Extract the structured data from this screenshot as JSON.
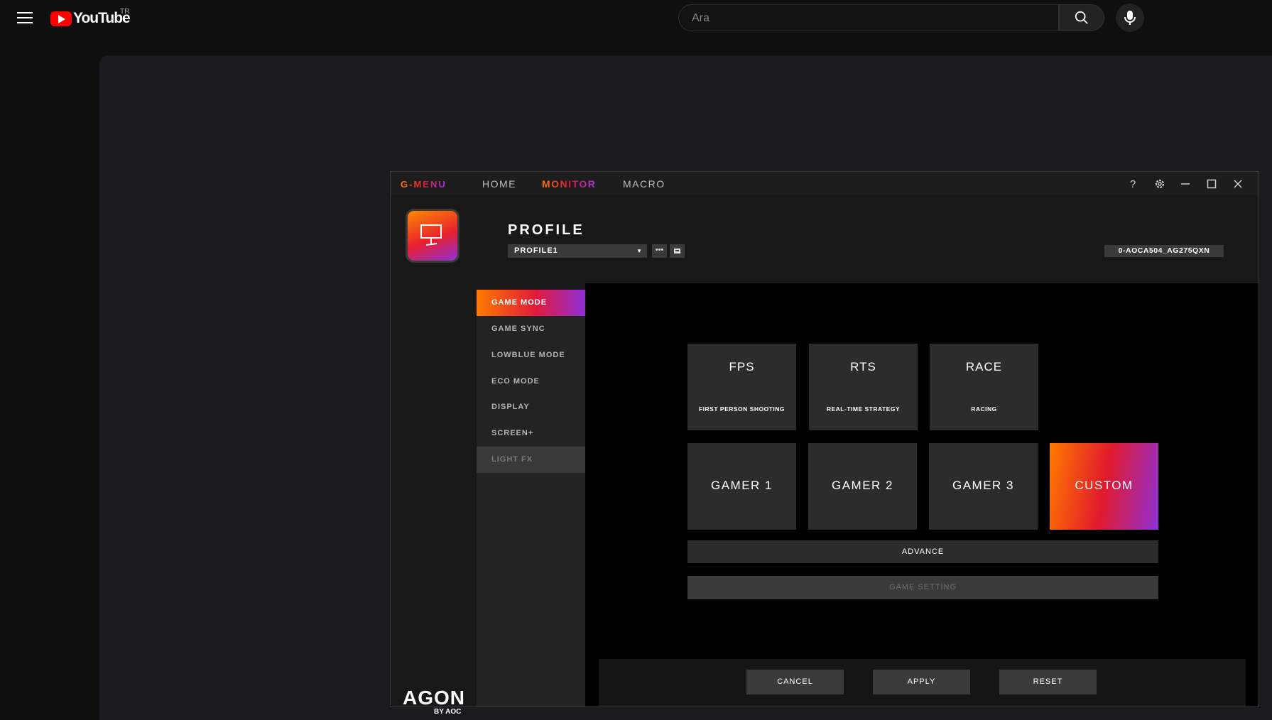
{
  "youtube": {
    "logo_text": "YouTube",
    "country": "TR",
    "search": {
      "placeholder": "Ara",
      "value": ""
    }
  },
  "gmenu": {
    "logo": "G-MENU",
    "nav": [
      {
        "label": "HOME",
        "active": false
      },
      {
        "label": "MONITOR",
        "active": true
      },
      {
        "label": "MACRO",
        "active": false
      }
    ],
    "window_controls": [
      "help-icon",
      "gear-icon",
      "minimize-icon",
      "maximize-icon",
      "close-icon"
    ],
    "profile": {
      "title": "PROFILE",
      "selected": "PROFILE1",
      "monitor_id": "0-AOCA504_AG275QXN"
    },
    "sidebar": [
      {
        "label": "GAME MODE",
        "state": "active"
      },
      {
        "label": "GAME SYNC",
        "state": "normal"
      },
      {
        "label": "LOWBLUE MODE",
        "state": "normal"
      },
      {
        "label": "ECO MODE",
        "state": "normal"
      },
      {
        "label": "DISPLAY",
        "state": "normal"
      },
      {
        "label": "SCREEN+",
        "state": "normal"
      },
      {
        "label": "LIGHT FX",
        "state": "disabled"
      }
    ],
    "modes": [
      {
        "title": "FPS",
        "subtitle": "FIRST PERSON SHOOTING"
      },
      {
        "title": "RTS",
        "subtitle": "REAL-TIME STRATEGY"
      },
      {
        "title": "RACE",
        "subtitle": "RACING"
      }
    ],
    "gamers": [
      {
        "title": "GAMER 1"
      },
      {
        "title": "GAMER 2"
      },
      {
        "title": "GAMER 3"
      },
      {
        "title": "CUSTOM",
        "selected": true
      }
    ],
    "advance_label": "ADVANCE",
    "game_setting_label": "GAME SETTING",
    "footer": {
      "cancel": "CANCEL",
      "apply": "APPLY",
      "reset": "RESET"
    },
    "brand": {
      "name": "AGON",
      "sub": "BY AOC"
    },
    "colors": {
      "accent_start": "#ff7a00",
      "accent_mid": "#e11a3c",
      "accent_end": "#8e2fd6"
    }
  }
}
